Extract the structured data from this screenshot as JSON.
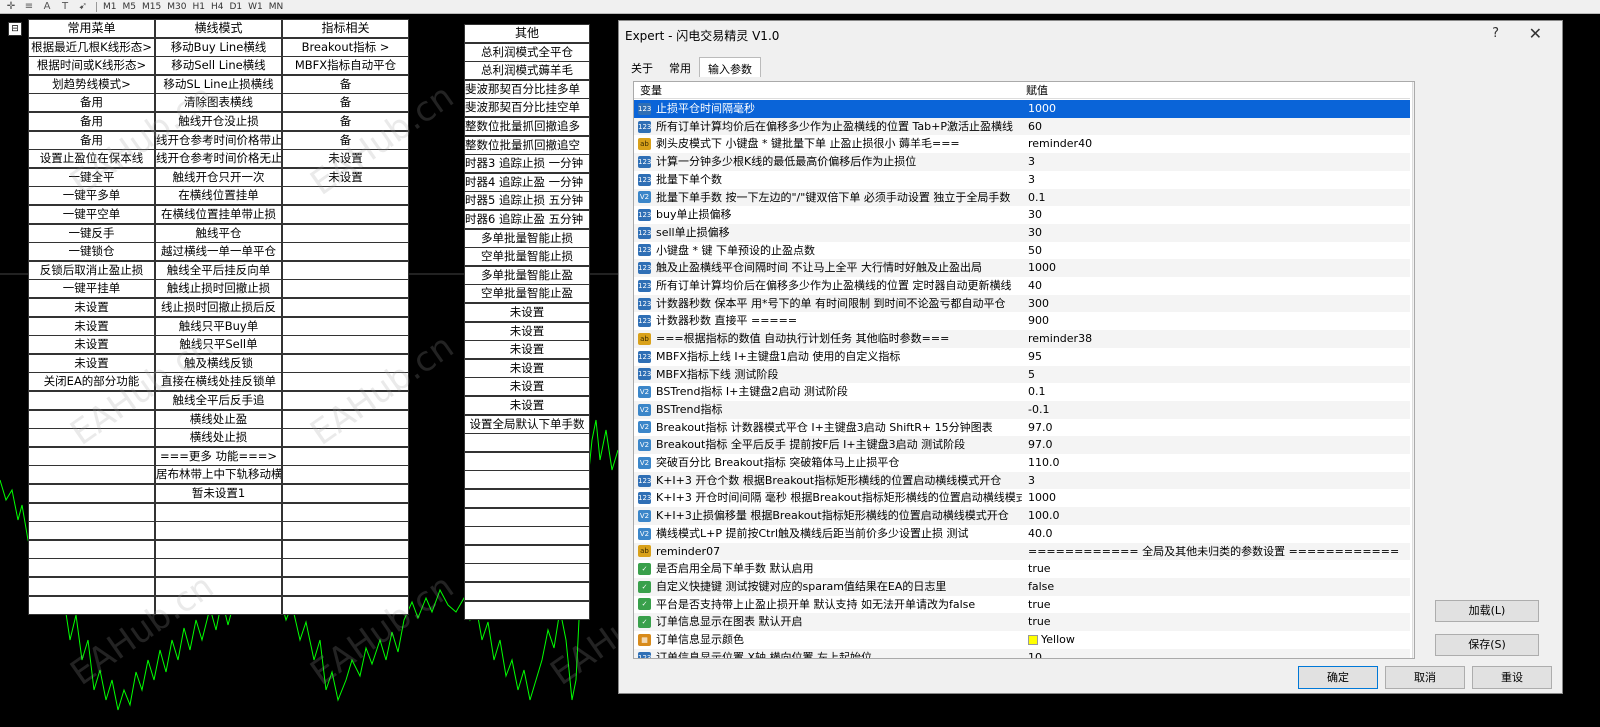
{
  "toolbar": {
    "timeframes": [
      "M1",
      "M5",
      "M15",
      "M30",
      "H1",
      "H4",
      "D1",
      "W1",
      "MN"
    ]
  },
  "grid_left": {
    "headers": [
      "常用菜单",
      "横线模式",
      "指标相关"
    ],
    "rows": [
      [
        "根据最近几根K线形态>",
        "移动Buy Line横线",
        "Breakout指标 >"
      ],
      [
        "根据时间或K线形态>",
        "移动Sell Line横线",
        "MBFX指标自动平仓"
      ],
      [
        "划趋势线模式>",
        "移动SL Line止损横线",
        "备"
      ],
      [
        "备用",
        "清除图表横线",
        "备"
      ],
      [
        "备用",
        "触线开仓没止损",
        "备"
      ],
      [
        "备用",
        "线开仓参考时间价格带止",
        "备"
      ],
      [
        "设置止盈位在保本线",
        "线开仓参考时间价格无止",
        "未设置"
      ],
      [
        "一键全平",
        "触线开仓只开一次",
        "未设置"
      ],
      [
        "一键平多单",
        "在横线位置挂单",
        ""
      ],
      [
        "一键平空单",
        "在横线位置挂单带止损",
        ""
      ],
      [
        "一键反手",
        "触线平仓",
        ""
      ],
      [
        "一键锁仓",
        "越过横线一单一单平仓",
        ""
      ],
      [
        "反锁后取消止盈止损",
        "触线全平后挂反向单",
        ""
      ],
      [
        "一键平挂单",
        "触线止损时回撤止损",
        ""
      ],
      [
        "未设置",
        "线止损时回撤止损后反",
        ""
      ],
      [
        "未设置",
        "触线只平Buy单",
        ""
      ],
      [
        "未设置",
        "触线只平Sell单",
        ""
      ],
      [
        "未设置",
        "触及横线反锁",
        ""
      ],
      [
        "关闭EA的部分功能",
        "直接在横线处挂反锁单",
        ""
      ],
      [
        "",
        "触线全平后反手追",
        ""
      ],
      [
        "",
        "横线处止盈",
        ""
      ],
      [
        "",
        "横线处止损",
        ""
      ],
      [
        "",
        "===更多 功能===>",
        ""
      ],
      [
        "",
        "居布林带上中下轨移动横",
        ""
      ],
      [
        "",
        "暂未设置1",
        ""
      ],
      [
        "",
        "",
        ""
      ],
      [
        "",
        "",
        ""
      ],
      [
        "",
        "",
        ""
      ],
      [
        "",
        "",
        ""
      ],
      [
        "",
        "",
        ""
      ],
      [
        "",
        "",
        ""
      ]
    ]
  },
  "grid_right": {
    "header": "其他",
    "rows": [
      "总利润模式全平仓",
      "总利润模式薅羊毛",
      "斐波那契百分比挂多单",
      "斐波那契百分比挂空单",
      "整数位批量抓回撤追多",
      "整数位批量抓回撤追空",
      "时器3 追踪止损 一分钟",
      "时器4 追踪止盈 一分钟",
      "时器5 追踪止损 五分钟",
      "时器6 追踪止盈 五分钟",
      "多单批量智能止损",
      "空单批量智能止损",
      "多单批量智能止盈",
      "空单批量智能止盈",
      "未设置",
      "未设置",
      "未设置",
      "未设置",
      "未设置",
      "未设置",
      "设置全局默认下单手数",
      "",
      "",
      "",
      "",
      "",
      "",
      "",
      "",
      "",
      ""
    ]
  },
  "dialog": {
    "title": "Expert - 闪电交易精灵 V1.0",
    "help": "?",
    "close": "✕",
    "tabs": [
      "关于",
      "常用",
      "输入参数"
    ],
    "active_tab": "输入参数",
    "col_var": "变量",
    "col_val": "赋值",
    "params": [
      {
        "type": "num",
        "name": "止损平仓时间隔毫秒",
        "value": "1000",
        "selected": true
      },
      {
        "type": "num",
        "name": "所有订单计算均价后在偏移多少作为止盈横线的位置 Tab+P激活止盈横线",
        "value": "60"
      },
      {
        "type": "str",
        "name": "剥头皮模式下 小键盘 * 键批量下单 止盈止损很小 薅羊毛===",
        "value": "reminder40"
      },
      {
        "type": "num",
        "name": "计算一分钟多少根K线的最低最高价偏移后作为止损位",
        "value": "3"
      },
      {
        "type": "num",
        "name": "批量下单个数",
        "value": "3"
      },
      {
        "type": "dbl",
        "name": "批量下单手数 按一下左边的\"/\"键双倍下单 必须手动设置 独立于全局手数",
        "value": "0.1"
      },
      {
        "type": "num",
        "name": "buy单止损偏移",
        "value": "30"
      },
      {
        "type": "num",
        "name": "sell单止损偏移",
        "value": "30"
      },
      {
        "type": "num",
        "name": "小键盘 * 键 下单预设的止盈点数",
        "value": "50"
      },
      {
        "type": "num",
        "name": "触及止盈横线平仓间隔时间 不让马上全平 大行情时好触及止盈出局",
        "value": "1000"
      },
      {
        "type": "num",
        "name": "所有订单计算均价后在偏移多少作为止盈横线的位置 定时器自动更新横线",
        "value": "40"
      },
      {
        "type": "num",
        "name": "计数器秒数 保本平 用*号下的单 有时间限制 到时间不论盈亏都自动平仓",
        "value": "300"
      },
      {
        "type": "num",
        "name": "计数器秒数 直接平   =====",
        "value": "900"
      },
      {
        "type": "str",
        "name": "===根据指标的数值 自动执行计划任务 其他临时参数===",
        "value": "reminder38"
      },
      {
        "type": "num",
        "name": "MBFX指标上线 I+主键盘1启动 使用的自定义指标",
        "value": "95"
      },
      {
        "type": "num",
        "name": "MBFX指标下线 测试阶段",
        "value": "5"
      },
      {
        "type": "dbl",
        "name": "BSTrend指标 I+主键盘2启动 测试阶段",
        "value": "0.1"
      },
      {
        "type": "dbl",
        "name": "BSTrend指标",
        "value": "-0.1"
      },
      {
        "type": "dbl",
        "name": "Breakout指标 计数器模式平仓 I+主键盘3启动 ShiftR+ 15分钟图表",
        "value": "97.0"
      },
      {
        "type": "dbl",
        "name": "Breakout指标 全平后反手 提前按F后  I+主键盘3启动 测试阶段",
        "value": "97.0"
      },
      {
        "type": "dbl",
        "name": "突破百分比 Breakout指标 突破箱体马上止损平仓",
        "value": "110.0"
      },
      {
        "type": "num",
        "name": "K+I+3 开仓个数 根据Breakout指标矩形横线的位置启动横线模式开仓",
        "value": "3"
      },
      {
        "type": "num",
        "name": "K+I+3 开仓时间间隔 毫秒 根据Breakout指标矩形横线的位置启动横线模式?..",
        "value": "1000"
      },
      {
        "type": "dbl",
        "name": "K+I+3止损偏移量  根据Breakout指标矩形横线的位置启动横线模式开仓",
        "value": "100.0"
      },
      {
        "type": "dbl",
        "name": "横线模式L+P 提前按Ctrl触及横线后距当前价多少设置止损 测试",
        "value": "40.0"
      },
      {
        "type": "str",
        "name": "reminder07",
        "value": "============ 全局及其他未归类的参数设置 ============"
      },
      {
        "type": "bool",
        "name": "是否启用全局下单手数 默认启用",
        "value": "true"
      },
      {
        "type": "bool",
        "name": "自定义快捷键 测试按键对应的sparam值结果在EA的日志里",
        "value": "false"
      },
      {
        "type": "bool",
        "name": "平台是否支持带上止盈止损开单 默认支持 如无法开单请改为false",
        "value": "true"
      },
      {
        "type": "bool",
        "name": "订单信息显示在图表 默认开启",
        "value": "true"
      },
      {
        "type": "col",
        "name": "订单信息显示颜色",
        "value": "Yellow"
      },
      {
        "type": "num",
        "name": "订单信息显示位置 X轴 横向位置 左上起始位",
        "value": "10"
      }
    ],
    "buttons": {
      "load": "加载(L)",
      "save": "保存(S)",
      "ok": "确定",
      "cancel": "取消",
      "reset": "重设"
    }
  },
  "watermark": "EAHub.cn",
  "colors": {
    "chart_line": "#00ff00",
    "selection": "#0a64d8"
  }
}
